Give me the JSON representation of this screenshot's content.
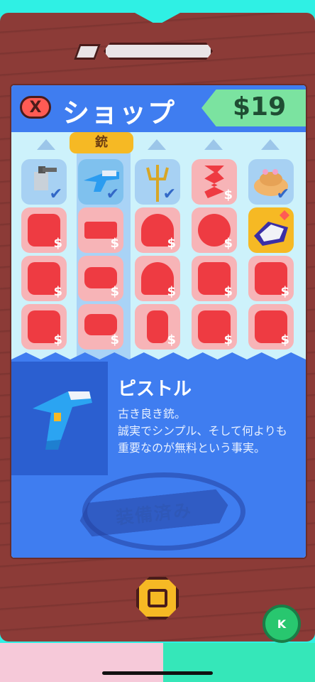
{
  "header": {
    "close_symbol": "X",
    "title": "ショップ",
    "money": "$19"
  },
  "tabs": {
    "selected_label": "銃"
  },
  "grid": {
    "owned_items": [
      {
        "name": "acorn-device-icon",
        "status": "owned"
      },
      {
        "name": "water-pistol-icon",
        "status": "owned"
      },
      {
        "name": "trident-icon",
        "status": "owned"
      },
      {
        "name": "spring-silhouette-icon",
        "status": "locked"
      },
      {
        "name": "bread-hat-icon",
        "status": "owned"
      }
    ],
    "price_symbol": "$"
  },
  "detail": {
    "name": "ピストル",
    "description": "古き良き銃。\n誠実でシンプル、そして何よりも重要なのが無料という事実。",
    "stamp_text": "装備済み"
  },
  "footer": {
    "k_label": "K"
  },
  "colors": {
    "header_blue": "#3f7df0",
    "money_green": "#7be3a0",
    "locked_red": "#ee3b42",
    "frame_brown": "#8c3b37"
  }
}
